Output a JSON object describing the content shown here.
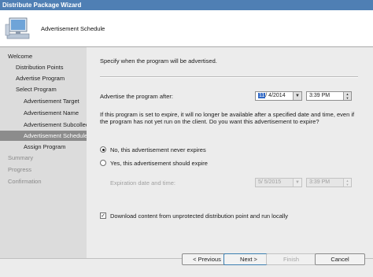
{
  "window": {
    "title": "Distribute Package Wizard"
  },
  "header": {
    "title": "Advertisement Schedule",
    "icon": "computer-monitor-icon"
  },
  "sidebar": {
    "items": [
      {
        "label": "Welcome",
        "state": "normal"
      },
      {
        "label": "Distribution Points",
        "state": "normal"
      },
      {
        "label": "Advertise Program",
        "state": "normal"
      },
      {
        "label": "Select Program",
        "state": "normal"
      },
      {
        "label": "Advertisement Target",
        "state": "normal"
      },
      {
        "label": "Advertisement Name",
        "state": "normal"
      },
      {
        "label": "Advertisement Subcollec",
        "state": "normal"
      },
      {
        "label": "Advertisement Schedule",
        "state": "active"
      },
      {
        "label": "Assign Program",
        "state": "normal"
      },
      {
        "label": "Summary",
        "state": "muted"
      },
      {
        "label": "Progress",
        "state": "muted"
      },
      {
        "label": "Confirmation",
        "state": "muted"
      }
    ]
  },
  "main": {
    "intro": "Specify when the program will be advertised.",
    "advertise_label": "Advertise the program after:",
    "advertise_date": {
      "highlight": "11",
      "rest": "/ 4/2014"
    },
    "advertise_time": "3:39 PM",
    "expire_question": "If this program is set to expire, it will no longer be available after a specified date and time, even if the program has not yet run on the client. Do you want this advertisement to expire?",
    "radio_never": "No, this advertisement never expires",
    "radio_expire": "Yes, this advertisement should expire",
    "expiration_label": "Expiration date and time:",
    "expiration_date": "5/ 5/2015",
    "expiration_time": "3:39 PM",
    "download_checkbox": "Download content from unprotected distribution point and run locally"
  },
  "buttons": {
    "previous": "< Previous",
    "next": "Next >",
    "finish": "Finish",
    "cancel": "Cancel"
  }
}
